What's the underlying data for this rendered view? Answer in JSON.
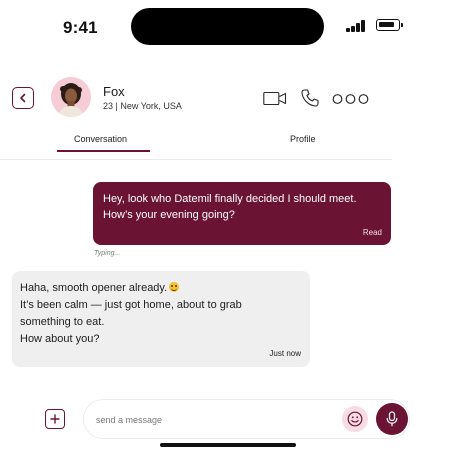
{
  "status_bar": {
    "time": "9:41"
  },
  "header": {
    "name": "Fox",
    "meta": "23 | New York, USA",
    "icons": [
      "back-icon",
      "video-call-icon",
      "phone-icon",
      "more-icon"
    ]
  },
  "tabs": [
    {
      "label": "Conversation",
      "active": true
    },
    {
      "label": "Profile",
      "active": false
    }
  ],
  "messages": {
    "outgoing": {
      "lines": [
        "Hey, look who Datemil finally decided I should meet.",
        "How’s your evening going?"
      ],
      "status": "Read"
    },
    "typing": "Typing...",
    "incoming": {
      "lines": [
        "Haha, smooth opener already.",
        "It’s been calm — just got home, about to grab",
        "something to eat.",
        "How about you?"
      ],
      "time": "Just now"
    }
  },
  "composer": {
    "placeholder": "send a message",
    "value": ""
  },
  "colors": {
    "accent": "#6b1333",
    "incoming_bubble": "#efefef",
    "emoji_button_bg": "#f8dbe4"
  }
}
